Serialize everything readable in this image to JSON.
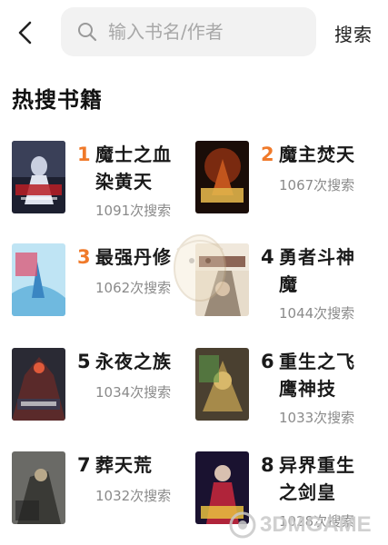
{
  "header": {
    "search_placeholder": "输入书名/作者",
    "search_button": "搜索"
  },
  "section_title": "热搜书籍",
  "books": [
    {
      "rank": "1",
      "title": "魔士之血染黄天",
      "count": "1091次搜索"
    },
    {
      "rank": "2",
      "title": "魔主焚天",
      "count": "1067次搜索"
    },
    {
      "rank": "3",
      "title": "最强丹修",
      "count": "1062次搜索"
    },
    {
      "rank": "4",
      "title": "勇者斗神魔",
      "count": "1044次搜索"
    },
    {
      "rank": "5",
      "title": "永夜之族",
      "count": "1034次搜索"
    },
    {
      "rank": "6",
      "title": "重生之飞鹰神技",
      "count": "1033次搜索"
    },
    {
      "rank": "7",
      "title": "葬天荒",
      "count": "1032次搜索"
    },
    {
      "rank": "8",
      "title": "异界重生之剑皇",
      "count": "1028次搜索"
    }
  ],
  "watermark": "3DMGAME",
  "colors": {
    "rank_top": "#f07a2a",
    "rank_normal": "#1a1a1a",
    "count": "#8a8a8a",
    "search_bg": "#f2f2f2"
  },
  "icons": {
    "back": "chevron-left-icon",
    "search": "search-icon"
  }
}
